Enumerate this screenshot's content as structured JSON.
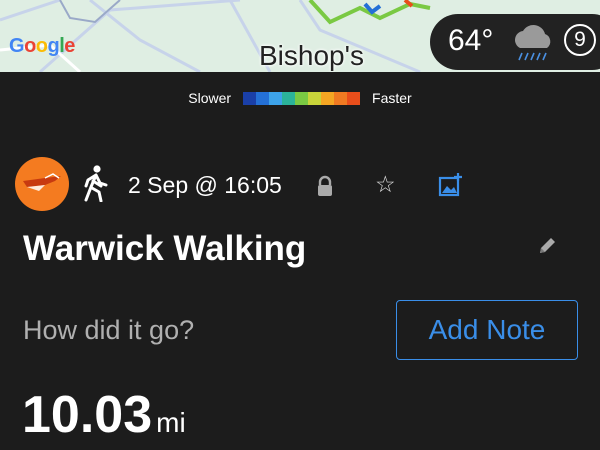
{
  "map": {
    "attribution": "Google",
    "place_label": "Bishop's"
  },
  "weather": {
    "temperature": "64°",
    "icon": "rain-cloud-icon",
    "badge": "9"
  },
  "pace_legend": {
    "slower_label": "Slower",
    "faster_label": "Faster",
    "colors": [
      "#1a3fa8",
      "#2470d6",
      "#3da3ea",
      "#2bb39a",
      "#7ac943",
      "#c8d43a",
      "#f5a623",
      "#f07a22",
      "#e94e1b"
    ]
  },
  "activity": {
    "avatar_icon": "strava-avatar-icon",
    "type_icon": "walking-icon",
    "date": "2 Sep @ 16:05",
    "title": "Warwick Walking",
    "feel_prompt": "How did it go?",
    "add_note_label": "Add Note",
    "distance": "10.03",
    "distance_unit": "mi"
  },
  "colors": {
    "background": "#1c1c1c",
    "accent": "#3a8ee8",
    "avatar": "#f47b20"
  }
}
